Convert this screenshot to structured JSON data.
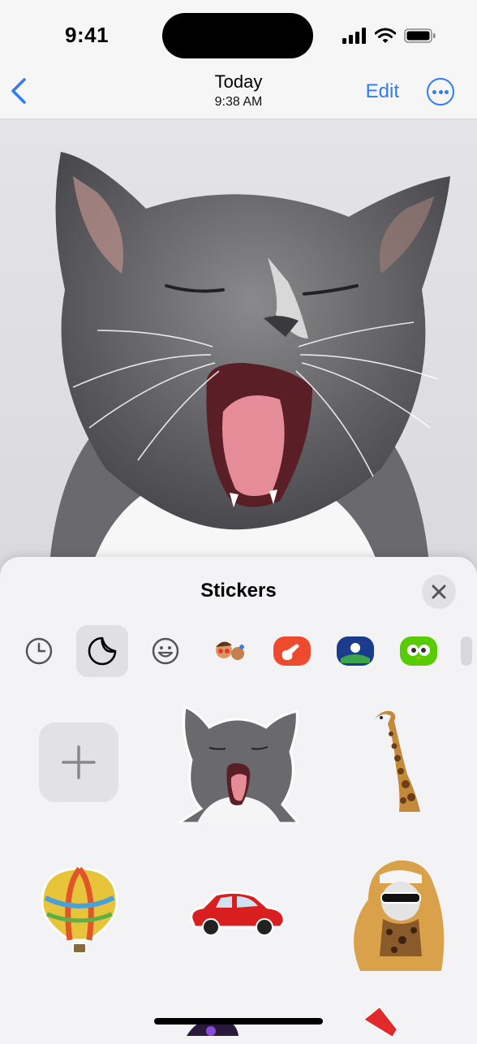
{
  "status": {
    "time": "9:41"
  },
  "nav": {
    "title": "Today",
    "subtitle": "9:38 AM",
    "edit_label": "Edit"
  },
  "sheet": {
    "title": "Stickers",
    "categories": [
      "recents-icon",
      "stickers-icon",
      "emoji-icon",
      "memoji-icon",
      "garageband-icon",
      "app-sticker-icon",
      "duolingo-icon"
    ],
    "stickers": [
      "cat-sticker",
      "giraffe-sticker",
      "hot-air-balloon-sticker",
      "red-car-sticker",
      "cat-in-hoodie-sticker"
    ]
  },
  "colors": {
    "accent": "#2f7cf6",
    "sheet_bg": "#f3f3f5"
  }
}
